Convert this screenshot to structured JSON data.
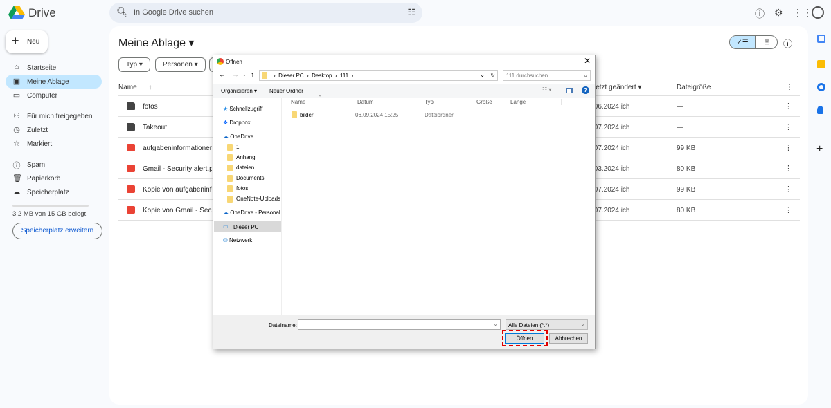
{
  "app": {
    "name": "Drive",
    "search_placeholder": "In Google Drive suchen"
  },
  "sidebar": {
    "new_label": "Neu",
    "items": [
      {
        "label": "Startseite",
        "icon": "home-icon"
      },
      {
        "label": "Meine Ablage",
        "icon": "drive-icon"
      },
      {
        "label": "Computer",
        "icon": "computer-icon"
      },
      {
        "label": "Für mich freigegeben",
        "icon": "people-icon"
      },
      {
        "label": "Zuletzt",
        "icon": "clock-icon"
      },
      {
        "label": "Markiert",
        "icon": "star-icon"
      },
      {
        "label": "Spam",
        "icon": "spam-icon"
      },
      {
        "label": "Papierkorb",
        "icon": "trash-icon"
      },
      {
        "label": "Speicherplatz",
        "icon": "cloud-icon"
      }
    ],
    "quota_text": "3,2 MB von 15 GB belegt",
    "quota_fraction": 0.0002,
    "upgrade_label": "Speicherplatz erweitern"
  },
  "main": {
    "title": "Meine Ablage",
    "filters": [
      "Typ",
      "Personen"
    ],
    "columns": {
      "name": "Name",
      "modified": "letzt geändert",
      "size": "Dateigröße"
    },
    "rows": [
      {
        "name": "fotos",
        "type": "folder",
        "modified": ".06.2024 ich",
        "size": "—"
      },
      {
        "name": "Takeout",
        "type": "folder",
        "modified": ".07.2024 ich",
        "size": "—"
      },
      {
        "name": "aufgabeninformationen-",
        "type": "image",
        "modified": ".07.2024 ich",
        "size": "99 KB"
      },
      {
        "name": "Gmail - Security alert.pd",
        "type": "pdf",
        "modified": ".03.2024 ich",
        "size": "80 KB"
      },
      {
        "name": "Kopie von aufgabeninfor",
        "type": "image",
        "modified": ".07.2024 ich",
        "size": "99 KB"
      },
      {
        "name": "Kopie von Gmail - Securi",
        "type": "pdf",
        "modified": ".07.2024 ich",
        "size": "80 KB"
      }
    ]
  },
  "dialog": {
    "title": "Öffnen",
    "path": [
      "Dieser PC",
      "Desktop",
      "111"
    ],
    "search_placeholder": "111 durchsuchen",
    "organize": "Organisieren ▾",
    "new_folder": "Neuer Ordner",
    "columns": [
      "Name",
      "Datum",
      "Typ",
      "Größe",
      "Länge"
    ],
    "files": [
      {
        "name": "bilder",
        "date": "06.09.2024 15:25",
        "type": "Dateiordner"
      }
    ],
    "nav": [
      {
        "label": "Schnellzugriff",
        "kind": "star"
      },
      {
        "label": "Dropbox",
        "kind": "dropbox"
      },
      {
        "label": "OneDrive",
        "kind": "cloud"
      },
      {
        "label": "1",
        "kind": "folder"
      },
      {
        "label": "Anhang",
        "kind": "folder"
      },
      {
        "label": "dateien",
        "kind": "folder"
      },
      {
        "label": "Documents",
        "kind": "folder"
      },
      {
        "label": "fotos",
        "kind": "folder"
      },
      {
        "label": "OneNote-Uploads",
        "kind": "folder"
      },
      {
        "label": "OneDrive - Personal",
        "kind": "cloud"
      },
      {
        "label": "Dieser PC",
        "kind": "pc"
      },
      {
        "label": "Netzwerk",
        "kind": "network"
      }
    ],
    "filename_label": "Dateiname:",
    "filename_value": "",
    "filter": "Alle Dateien (*.*)",
    "open": "Öffnen",
    "cancel": "Abbrechen"
  },
  "colors": {
    "accent": "#c2e7ff",
    "highlight": "#e00000"
  }
}
